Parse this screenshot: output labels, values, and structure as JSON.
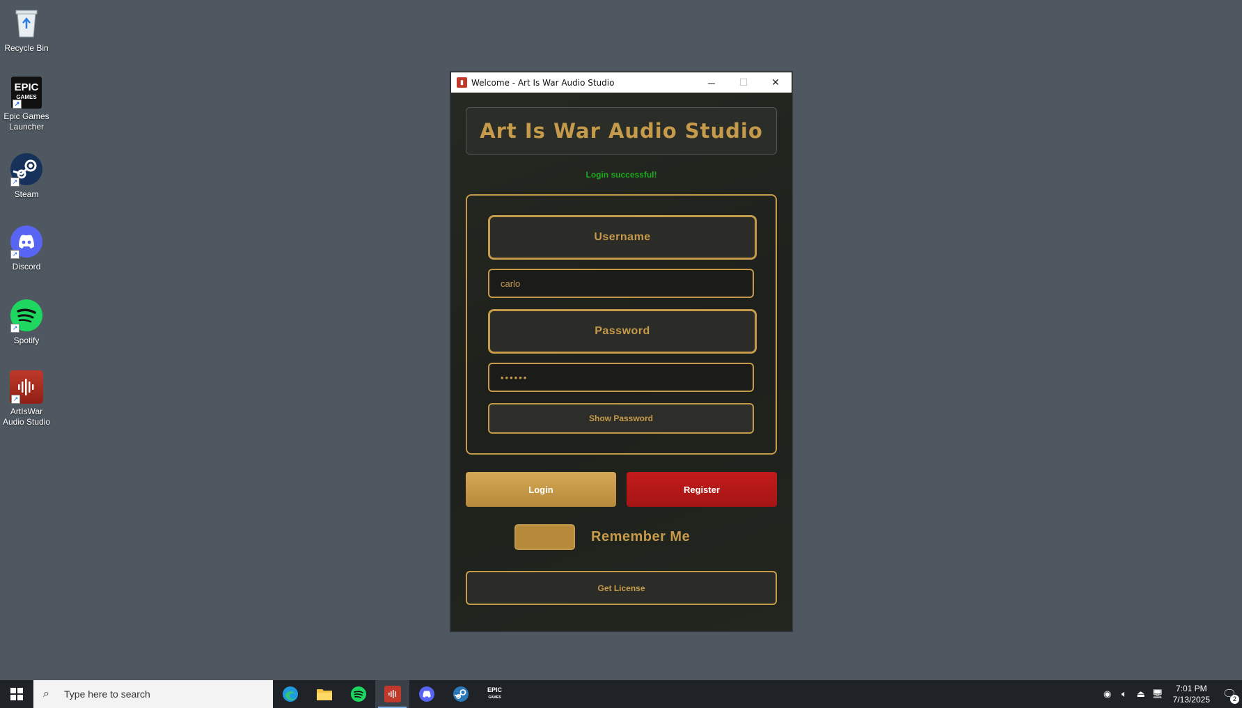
{
  "desktop": {
    "icons": [
      {
        "label": "Recycle Bin",
        "icon": "recycle-bin-icon"
      },
      {
        "label": "Epic Games Launcher",
        "icon": "epic-games-icon"
      },
      {
        "label": "Steam",
        "icon": "steam-icon"
      },
      {
        "label": "Discord",
        "icon": "discord-icon"
      },
      {
        "label": "Spotify",
        "icon": "spotify-icon"
      },
      {
        "label": "ArtIsWar Audio Studio",
        "icon": "artiswar-icon"
      }
    ]
  },
  "window": {
    "title": "Welcome - Art Is War Audio Studio",
    "header": "Art Is War Audio Studio",
    "status": "Login successful!",
    "status_color": "#1fa91f",
    "accent": "#c59a4a",
    "username_label": "Username",
    "username_value": "carlo",
    "password_label": "Password",
    "password_value": "••••••",
    "show_password": "Show Password",
    "login": "Login",
    "register": "Register",
    "remember_me": "Remember Me",
    "get_license": "Get License"
  },
  "taskbar": {
    "search_placeholder": "Type here to search",
    "apps": [
      "edge-icon",
      "file-explorer-icon",
      "spotify-icon",
      "artiswar-icon",
      "discord-icon",
      "steam-icon",
      "epic-games-icon"
    ],
    "time": "7:01 PM",
    "date": "7/13/2025",
    "notifications": "2"
  }
}
